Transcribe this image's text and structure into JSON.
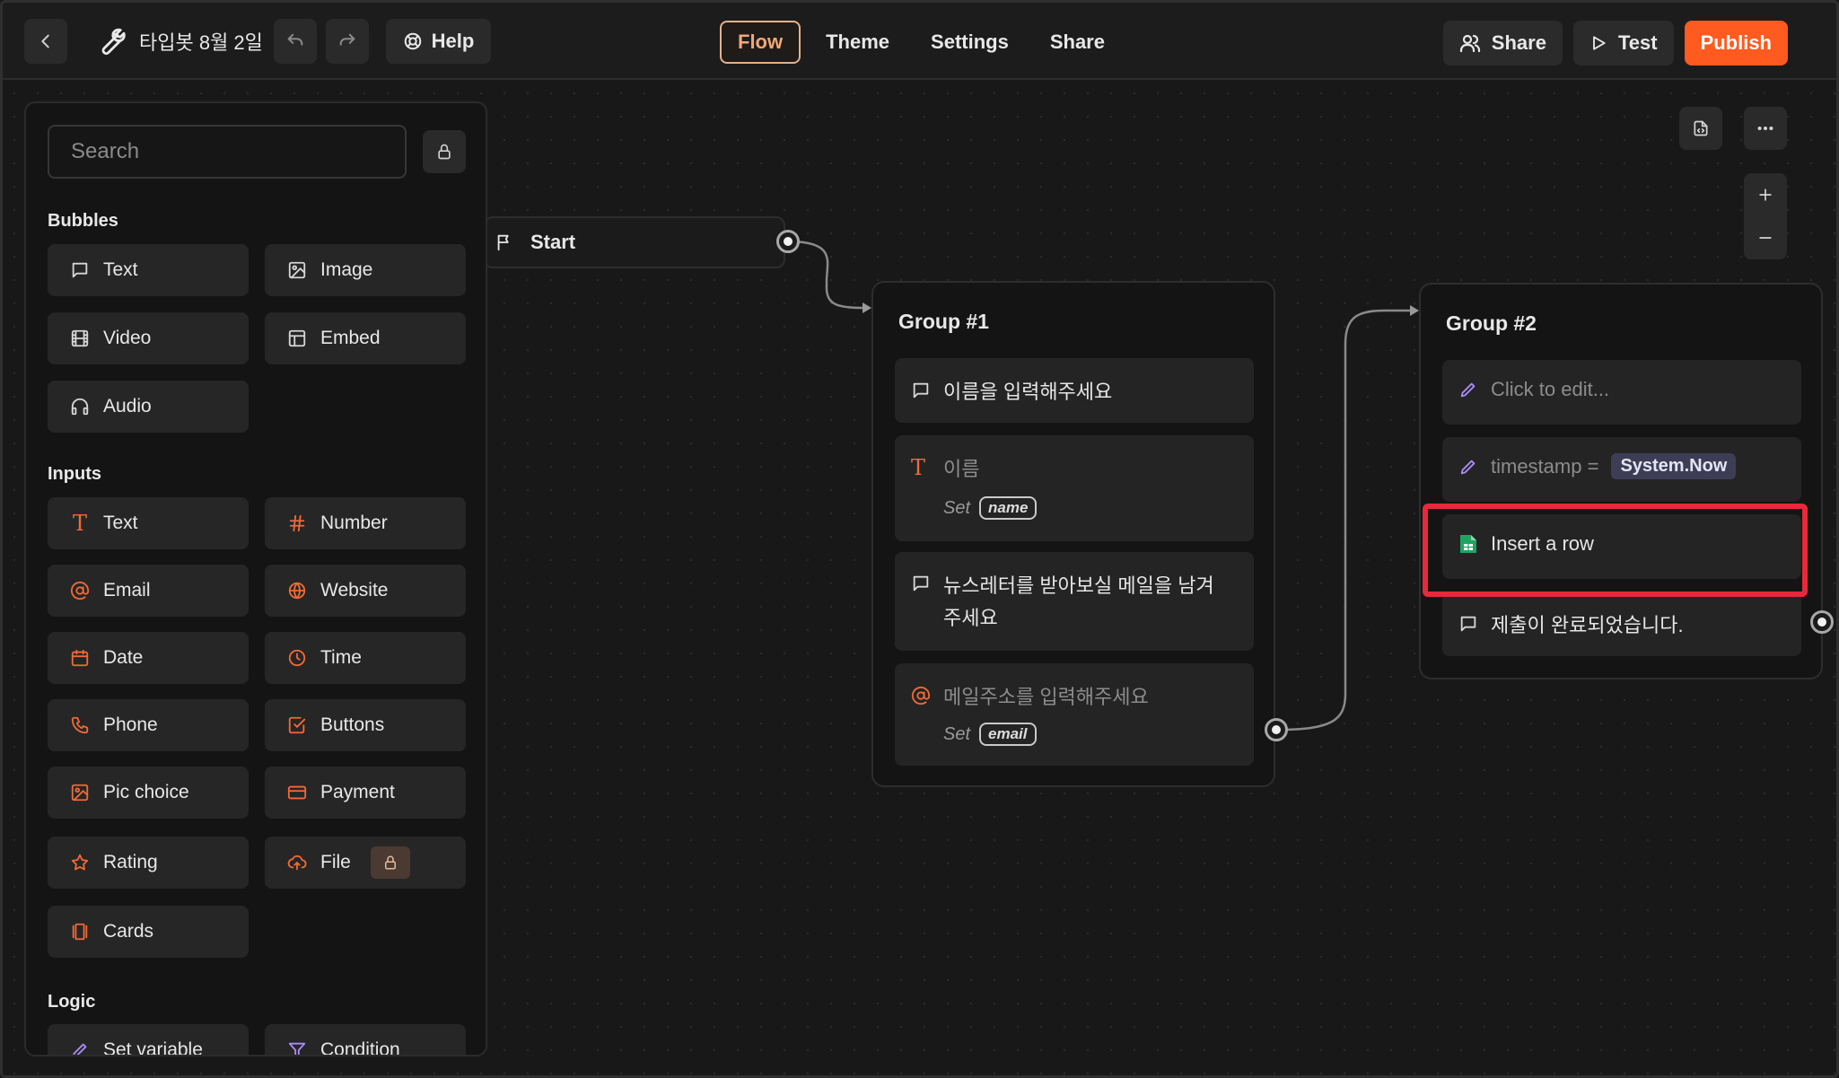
{
  "header": {
    "title": "타입봇 8월 2일",
    "help_label": "Help",
    "nav": [
      "Flow",
      "Theme",
      "Settings",
      "Share"
    ],
    "active_nav": "Flow",
    "share_label": "Share",
    "test_label": "Test",
    "publish_label": "Publish"
  },
  "sidebar": {
    "search_placeholder": "Search",
    "sections": {
      "bubbles": "Bubbles",
      "inputs": "Inputs",
      "logic": "Logic"
    },
    "bubbles": [
      "Text",
      "Image",
      "Video",
      "Embed",
      "Audio"
    ],
    "inputs": [
      "Text",
      "Number",
      "Email",
      "Website",
      "Date",
      "Time",
      "Phone",
      "Buttons",
      "Pic choice",
      "Payment",
      "Rating",
      "File",
      "Cards"
    ],
    "logic": [
      "Set variable",
      "Condition"
    ]
  },
  "flow": {
    "start_label": "Start",
    "group1": {
      "title": "Group #1",
      "block1": "이름을 입력해주세요",
      "block2_placeholder": "이름",
      "block2_set": "Set",
      "block2_var": "name",
      "block3_line1": "뉴스레터를 받아보실 메일을 남겨",
      "block3_line2": "주세요",
      "block4_placeholder": "메일주소를 입력해주세요",
      "block4_set": "Set",
      "block4_var": "email"
    },
    "group2": {
      "title": "Group #2",
      "block1": "Click to edit...",
      "block2_var": "timestamp =",
      "block2_value": "System.Now",
      "block3": "Insert a row",
      "block4": "제출이 완료되었습니다."
    }
  },
  "colors": {
    "accent": "#ff5a1f",
    "input_icon": "#f06a35",
    "logic_icon": "#a98bf5",
    "highlight": "#e8283b",
    "sheets_green": "#1fa463"
  }
}
